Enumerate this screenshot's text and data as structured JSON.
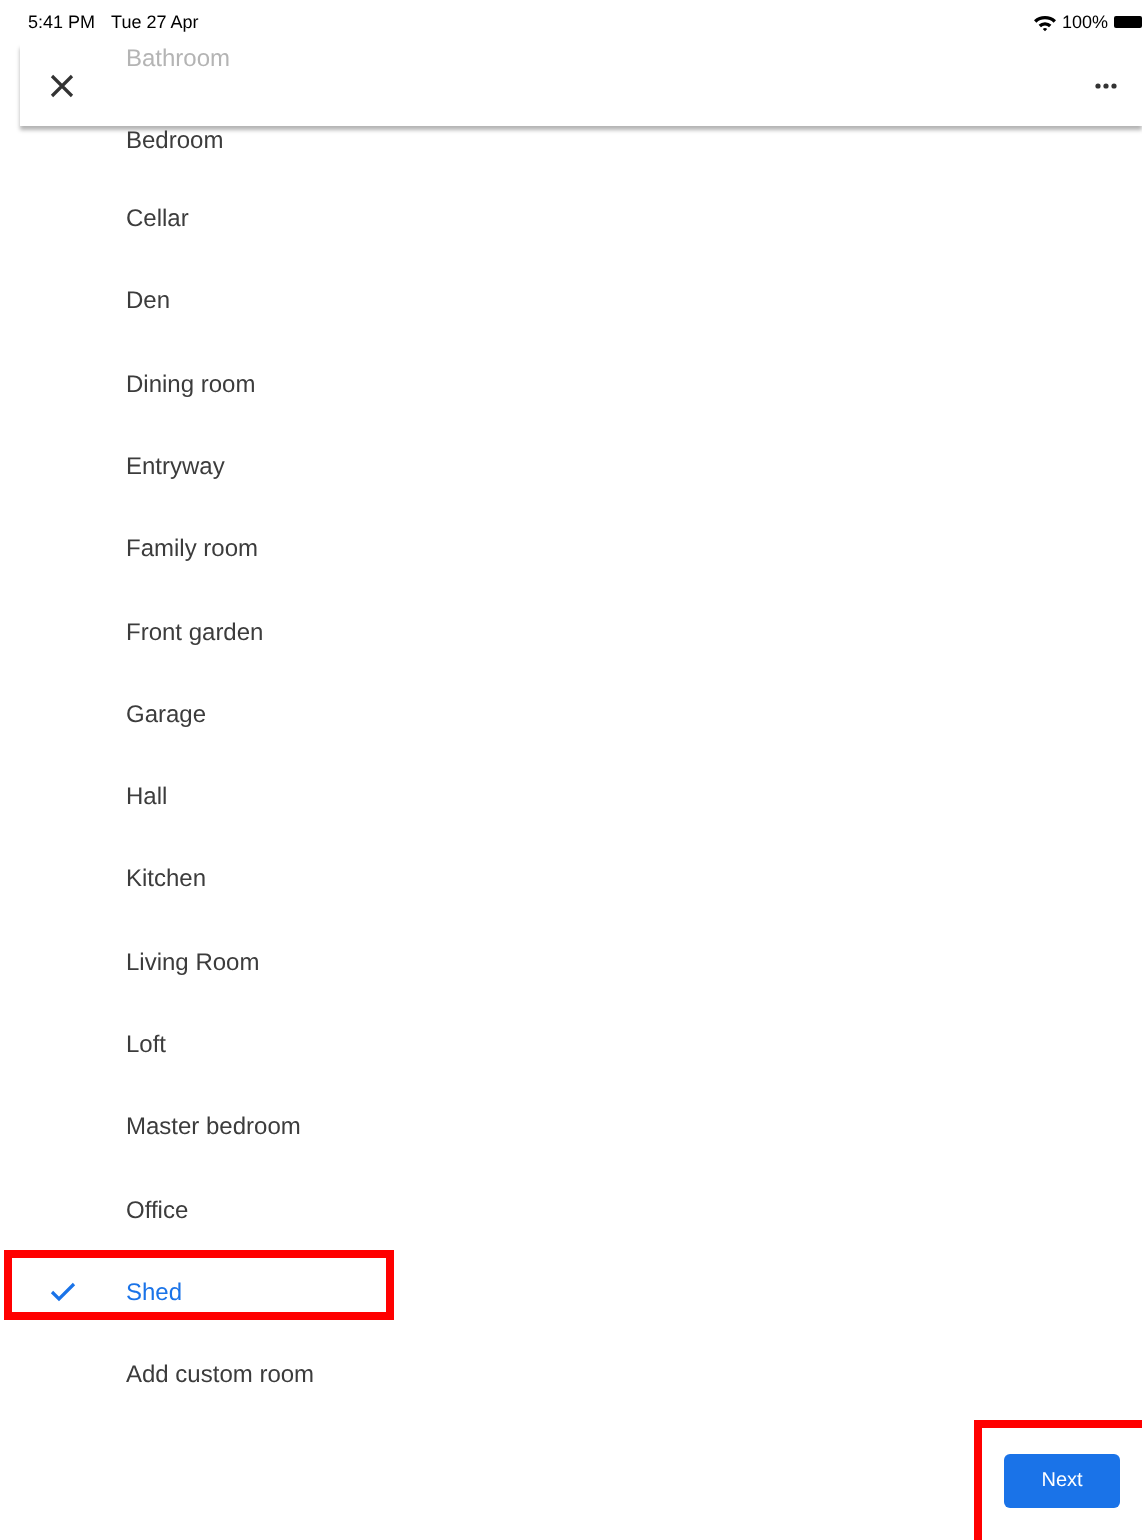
{
  "status_bar": {
    "time": "5:41 PM",
    "date": "Tue 27 Apr",
    "battery": "100%"
  },
  "header": {
    "hidden_item": "Bathroom"
  },
  "rooms": [
    {
      "label": "Bedroom",
      "selected": false,
      "highlighted": false
    },
    {
      "label": "Cellar",
      "selected": false,
      "highlighted": false
    },
    {
      "label": "Den",
      "selected": false,
      "highlighted": false
    },
    {
      "label": "Dining room",
      "selected": false,
      "highlighted": false
    },
    {
      "label": "Entryway",
      "selected": false,
      "highlighted": false
    },
    {
      "label": "Family room",
      "selected": false,
      "highlighted": false
    },
    {
      "label": "Front garden",
      "selected": false,
      "highlighted": false
    },
    {
      "label": "Garage",
      "selected": false,
      "highlighted": false
    },
    {
      "label": "Hall",
      "selected": false,
      "highlighted": false
    },
    {
      "label": "Kitchen",
      "selected": false,
      "highlighted": false
    },
    {
      "label": "Living Room",
      "selected": false,
      "highlighted": false
    },
    {
      "label": "Loft",
      "selected": false,
      "highlighted": false
    },
    {
      "label": "Master bedroom",
      "selected": false,
      "highlighted": false
    },
    {
      "label": "Office",
      "selected": false,
      "highlighted": false
    },
    {
      "label": "Shed",
      "selected": true,
      "highlighted": true
    },
    {
      "label": "Add custom room",
      "selected": false,
      "highlighted": false
    }
  ],
  "next_button": {
    "label": "Next",
    "highlighted": true
  }
}
